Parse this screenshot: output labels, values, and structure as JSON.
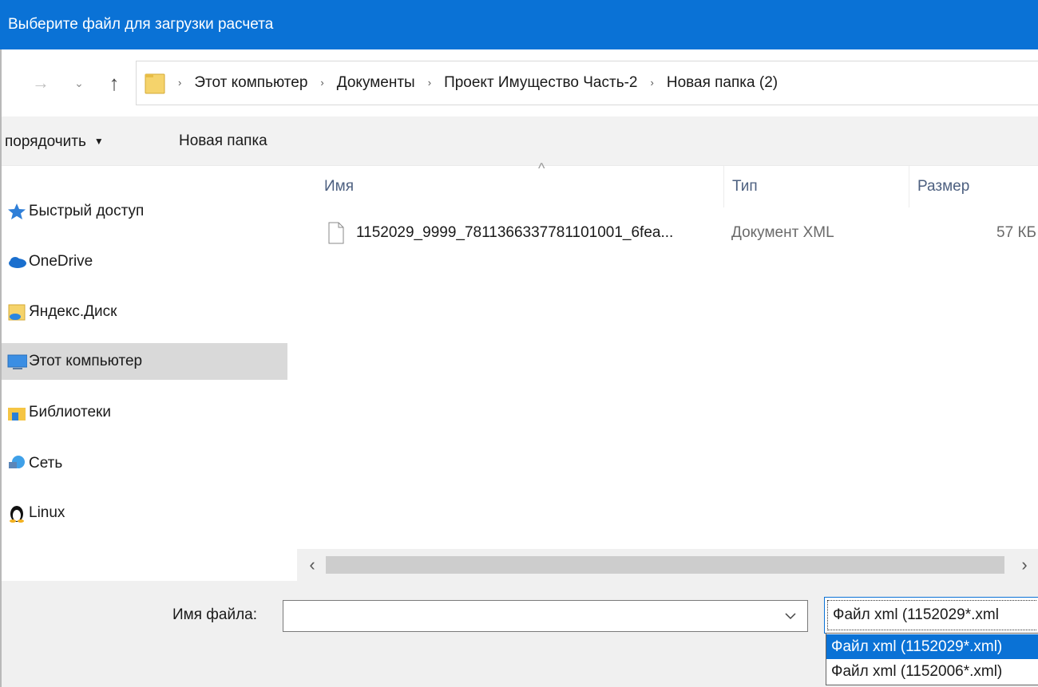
{
  "window": {
    "title": "Выберите файл для загрузки расчета"
  },
  "navigation": {
    "back_glyph": "→",
    "history_glyph": "⌄",
    "up_glyph": "↑",
    "breadcrumb": [
      "Этот компьютер",
      "Документы",
      "Проект Имущество Часть-2",
      "Новая папка (2)"
    ],
    "separator": "›"
  },
  "toolbar": {
    "organize_label": "порядочить",
    "organize_caret": "▼",
    "new_folder_label": "Новая папка"
  },
  "sidebar": {
    "items": [
      {
        "label": "Быстрый доступ",
        "icon": "star-icon"
      },
      {
        "label": "OneDrive",
        "icon": "cloud-icon"
      },
      {
        "label": "Яндекс.Диск",
        "icon": "yandex-disk-icon"
      },
      {
        "label": "Этот компьютер",
        "icon": "computer-icon",
        "selected": true
      },
      {
        "label": "Библиотеки",
        "icon": "library-icon"
      },
      {
        "label": "Сеть",
        "icon": "network-icon"
      },
      {
        "label": "Linux",
        "icon": "linux-penguin-icon"
      }
    ]
  },
  "file_list": {
    "columns": {
      "name": "Имя",
      "type": "Тип",
      "size": "Размер"
    },
    "sort_glyph": "^",
    "rows": [
      {
        "name": "1152029_9999_7811366337781101001_6fea...",
        "type": "Документ XML",
        "size": "57 КБ"
      }
    ]
  },
  "scrollbar": {
    "left_glyph": "‹",
    "right_glyph": "›"
  },
  "footer": {
    "filename_label": "Имя файла:",
    "filename_value": "",
    "filetype_selected": "Файл xml (1152029*.xml",
    "filetype_options": [
      "Файл xml (1152029*.xml)",
      "Файл xml (1152006*.xml)"
    ]
  },
  "colors": {
    "titlebar": "#0a72d6",
    "selection": "#0a72d6",
    "nav_selected": "#d9d9d9",
    "toolbar_bg": "#f2f2f2",
    "footer_bg": "#f0f0f0"
  }
}
